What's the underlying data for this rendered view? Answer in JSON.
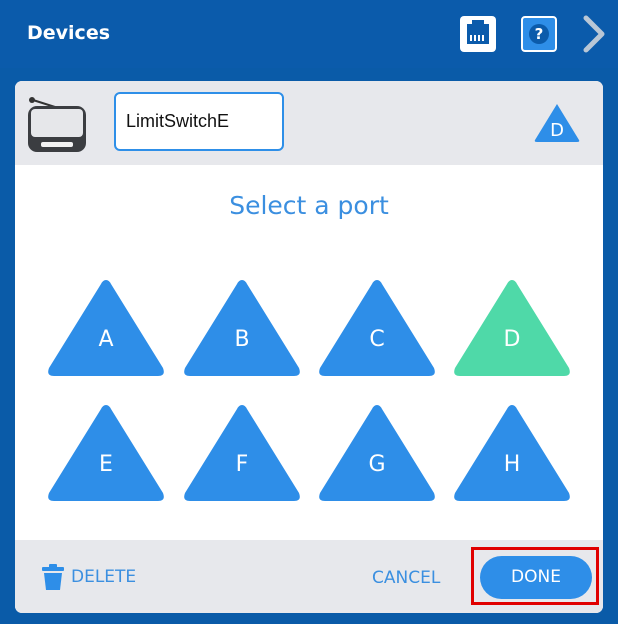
{
  "titlebar": {
    "title": "Devices",
    "icons": [
      "ethernet-port-icon",
      "help-icon",
      "chevron-right-icon"
    ],
    "help_glyph": "?"
  },
  "device": {
    "icon": "limit-switch-device-icon",
    "name_value": "LimitSwitchE",
    "assigned_port": "D"
  },
  "port_picker": {
    "prompt": "Select a port",
    "ports": [
      {
        "label": "A",
        "selected": false
      },
      {
        "label": "B",
        "selected": false
      },
      {
        "label": "C",
        "selected": false
      },
      {
        "label": "D",
        "selected": true
      },
      {
        "label": "E",
        "selected": false
      },
      {
        "label": "F",
        "selected": false
      },
      {
        "label": "G",
        "selected": false
      },
      {
        "label": "H",
        "selected": false
      }
    ]
  },
  "footer": {
    "delete_label": "DELETE",
    "cancel_label": "CANCEL",
    "done_label": "DONE"
  },
  "colors": {
    "titlebar": "#0b5bab",
    "accent": "#2e8ee8",
    "port_default": "#2e8ee8",
    "port_selected": "#4fd9a8",
    "panel": "#e7e8ec",
    "highlight_box": "#e00000"
  }
}
